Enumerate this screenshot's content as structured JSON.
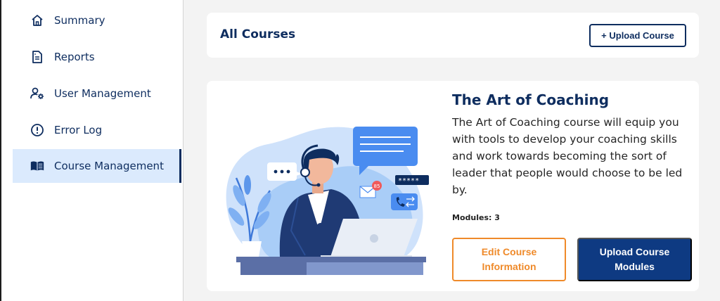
{
  "sidebar": {
    "items": [
      {
        "label": "Summary",
        "icon": "home-icon"
      },
      {
        "label": "Reports",
        "icon": "document-icon"
      },
      {
        "label": "User Management",
        "icon": "user-settings-icon"
      },
      {
        "label": "Error Log",
        "icon": "alert-circle-icon"
      },
      {
        "label": "Course Management",
        "icon": "book-icon",
        "active": true
      }
    ]
  },
  "header": {
    "title": "All Courses",
    "upload_label": "+ Upload Course"
  },
  "course": {
    "title": "The Art of Coaching",
    "description": "The Art of Coaching course will equip you with tools to develop your coaching skills and work towards becoming the sort of leader that people would choose to be led by.",
    "modules_label": "Modules: 3",
    "edit_label": "Edit Course Information",
    "upload_modules_label": "Upload Course Modules",
    "illustration": {
      "badge_count": "85",
      "password_mask": "*****"
    }
  },
  "colors": {
    "primary": "#0e2d5f",
    "primary_button": "#0e3a82",
    "accent": "#ef8a2a",
    "active_nav_bg": "#dbeafd"
  }
}
